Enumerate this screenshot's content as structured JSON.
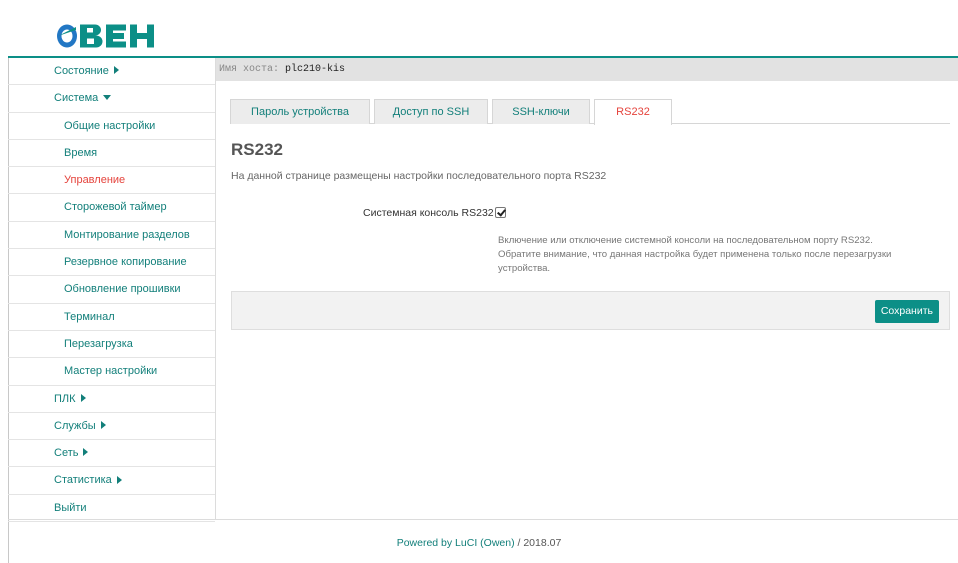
{
  "header": {
    "logo_text": "ОВЕН"
  },
  "host": {
    "label": "Имя хоста:",
    "value": "plc210-kis"
  },
  "sidebar": {
    "items": [
      {
        "label": "Состояние",
        "kind": "top",
        "caret": "right"
      },
      {
        "label": "Система",
        "kind": "top",
        "caret": "down"
      },
      {
        "label": "Общие настройки",
        "kind": "sub"
      },
      {
        "label": "Время",
        "kind": "sub"
      },
      {
        "label": "Управление",
        "kind": "sub",
        "active": true
      },
      {
        "label": "Сторожевой таймер",
        "kind": "sub"
      },
      {
        "label": "Монтирование разделов",
        "kind": "sub"
      },
      {
        "label": "Резервное копирование",
        "kind": "sub"
      },
      {
        "label": "Обновление прошивки",
        "kind": "sub"
      },
      {
        "label": "Терминал",
        "kind": "sub"
      },
      {
        "label": "Перезагрузка",
        "kind": "sub"
      },
      {
        "label": "Мастер настройки",
        "kind": "sub"
      },
      {
        "label": "ПЛК",
        "kind": "top",
        "caret": "right"
      },
      {
        "label": "Службы",
        "kind": "top",
        "caret": "right"
      },
      {
        "label": "Сеть",
        "kind": "top",
        "caret": "right"
      },
      {
        "label": "Статистика",
        "kind": "top",
        "caret": "right"
      },
      {
        "label": "Выйти",
        "kind": "top"
      }
    ]
  },
  "tabs": [
    {
      "label": "Пароль устройства"
    },
    {
      "label": "Доступ по SSH"
    },
    {
      "label": "SSH-ключи"
    },
    {
      "label": "RS232",
      "active": true
    }
  ],
  "main": {
    "title": "RS232",
    "description": "На данной странице размещены настройки последовательного порта RS232",
    "field_label": "Системная консоль RS232",
    "field_checked": true,
    "help_text": "Включение или отключение системной консоли на последовательном порту RS232. Обратите внимание, что данная настройка будет применена только после перезагрузки устройства.",
    "save_label": "Сохранить"
  },
  "footer": {
    "link_text": "Powered by LuCI (Owen)",
    "version": "/ 2018.07"
  },
  "colors": {
    "accent": "#0c8f87",
    "link": "#127f7a",
    "active": "#e5443d",
    "logo_blue": "#2277c4",
    "logo_green": "#0c8f87"
  }
}
